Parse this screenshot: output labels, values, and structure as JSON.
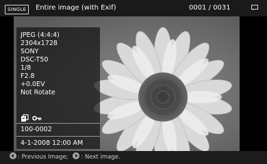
{
  "header": {
    "mode_badge": "SINGLE",
    "mode_label": "Entire image (with Exif)",
    "counter": "0001 / 0031"
  },
  "exif": {
    "lines": [
      "JPEG (4:4:4)",
      "2304x1728",
      "SONY",
      "DSC-T50",
      "1/8",
      "F2.8",
      "+0.0EV",
      "Not Rotate"
    ],
    "file_number": "100-0002",
    "datetime": "4-1-2008 12:00 AM"
  },
  "footer": {
    "prev_label": ": Previous Image;",
    "next_label": ": Next image."
  },
  "icons": {
    "info": "info-icon",
    "protect": "protect-icon",
    "key": "key-icon",
    "prev": "prev-arrow-icon",
    "next": "next-arrow-icon"
  }
}
